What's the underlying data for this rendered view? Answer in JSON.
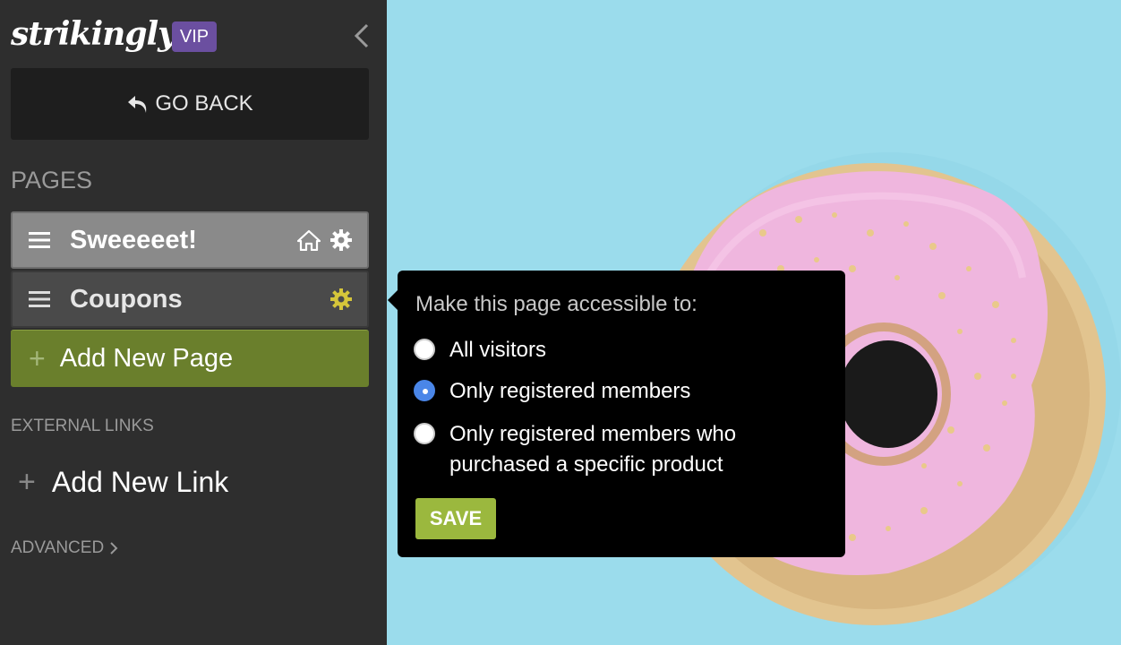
{
  "sidebar": {
    "logo": "strikingly",
    "badge": "VIP",
    "go_back": "GO BACK",
    "pages_heading": "PAGES",
    "pages": [
      {
        "label": "Sweeeeet!"
      },
      {
        "label": "Coupons"
      }
    ],
    "add_page": "Add New Page",
    "external_links_heading": "EXTERNAL LINKS",
    "add_link": "Add New Link",
    "advanced": "ADVANCED"
  },
  "popover": {
    "title": "Make this page accessible to:",
    "options": [
      {
        "label": "All visitors",
        "selected": false
      },
      {
        "label": "Only registered members",
        "selected": true
      },
      {
        "label_line1": "Only registered members who",
        "label_line2": "purchased a specific product",
        "selected": false
      }
    ],
    "save": "SAVE"
  },
  "colors": {
    "sidebar_bg": "#2e2e2e",
    "vip_badge": "#6b4fa0",
    "add_page_green": "#6a7f2c",
    "save_green": "#9bb83e",
    "radio_selected": "#4a86e8",
    "gear_active": "#d6c63a",
    "background": "#9bdcec"
  },
  "icons": [
    "back-arrow-icon",
    "chevron-left-icon",
    "drag-handle-icon",
    "home-icon",
    "gear-icon",
    "plus-icon",
    "chevron-right-icon"
  ]
}
